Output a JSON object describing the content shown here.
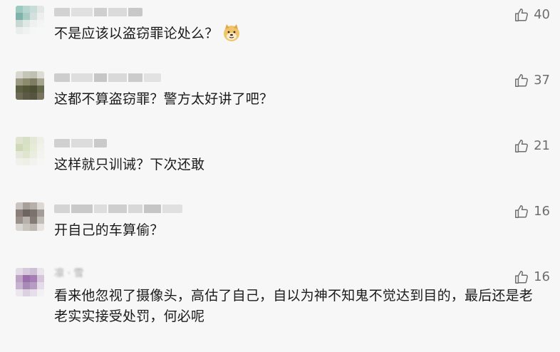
{
  "comments": [
    {
      "text": "不是应该以盗窃罪论处么？",
      "likes": "40",
      "emoji_icon": "doge-emoji-icon",
      "avatar_colors": [
        "#9cc9c0",
        "#b8d6cf",
        "#c9ddd8",
        "#e1e7e5",
        "#7fb2a9",
        "#a9ccc4",
        "#d4e0dd",
        "#ecefee",
        "#c8d8d4",
        "#dfe8e5",
        "#eef1f0",
        "#f3f4f4",
        "#e9eeec",
        "#f0f2f1",
        "#f5f6f6",
        "#f7f7f7"
      ],
      "nickname_colors": [
        "#d2d2d2",
        "#e0e0e0",
        "#cfcfcf",
        "#dadada",
        "#c8c8c8"
      ]
    },
    {
      "text": "这都不算盗窃罪？警方太好讲了吧？",
      "likes": "37",
      "avatar_colors": [
        "#d8d8d0",
        "#c4c7b7",
        "#bfc2b0",
        "#dcdcd4",
        "#9c9a82",
        "#8c8b6e",
        "#7e7d62",
        "#a5a48e",
        "#5e6044",
        "#545638",
        "#4c4f33",
        "#66684c",
        "#6d6a55",
        "#5c5a46",
        "#565340",
        "#77735e"
      ],
      "nickname_colors": [
        "#cdcdcd",
        "#dedede",
        "#c6c6c6",
        "#d9d9d9",
        "#cbcbcb",
        "#e2e2e2"
      ]
    },
    {
      "text": "这样就只训诫？下次还敢",
      "likes": "21",
      "avatar_colors": [
        "#dfe3cf",
        "#d6e0c6",
        "#e4e8d8",
        "#eef0e8",
        "#cfd8b8",
        "#d9e3c4",
        "#e7ecd9",
        "#f1f2ec",
        "#e6e8dc",
        "#dfe5cf",
        "#eaeee1",
        "#f3f4ef",
        "#f0f1eb",
        "#eef0e7",
        "#f2f3ef",
        "#f6f6f4"
      ],
      "nickname_colors": [
        "#d0d0d0",
        "#dcdcdc",
        "#cacaca"
      ]
    },
    {
      "text": "开自己的车算偷？",
      "likes": "16",
      "avatar_colors": [
        "#c9c4c0",
        "#a79f99",
        "#b7b0aa",
        "#dcd8d4",
        "#8a7f79",
        "#6f6560",
        "#7c726c",
        "#a49c96",
        "#9a918b",
        "#b8b1ab",
        "#857b75",
        "#c3bdb8",
        "#d9d5d1",
        "#c9c3be",
        "#bfb8b2",
        "#e6e3e0"
      ],
      "nickname_colors": [
        "#d4d4d4",
        "#c9c9c9",
        "#dddddd",
        "#cecece",
        "#d8d8d8",
        "#c5c5c5",
        "#e0e0e0"
      ]
    },
    {
      "text": "看来他忽视了摄像头，高估了自己，自以为神不知鬼不觉达到目的，最后还是老老实实接受处罚，何必呢",
      "likes": "16",
      "avatar_colors": [
        "#e3dbe6",
        "#d7c9dc",
        "#cfbfd6",
        "#eae4ed",
        "#bda3c6",
        "#9a6fab",
        "#a57fb4",
        "#d5c6dc",
        "#c8b4d0",
        "#a98ab6",
        "#b89dc3",
        "#e4dce8",
        "#ece7ee",
        "#dcd1e1",
        "#e6dfe9",
        "#f3f0f4"
      ],
      "nickname_text": "凛 · 雪",
      "nickname_colors": []
    }
  ],
  "icons": {
    "like": "thumbs-up-icon"
  }
}
